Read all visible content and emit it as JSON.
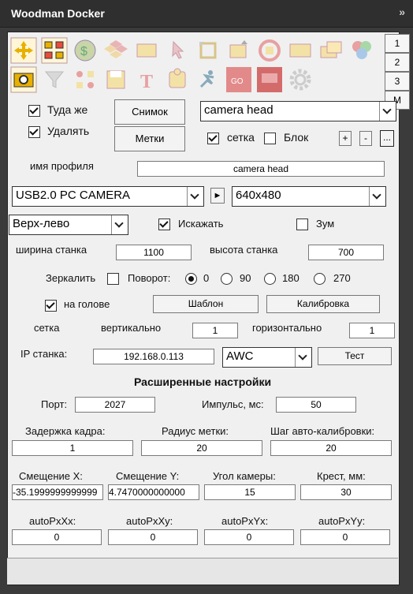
{
  "window": {
    "title": "Woodman Docker",
    "expand_icon": "double-chevron-right"
  },
  "tabs": [
    "1",
    "2",
    "3",
    "M"
  ],
  "toolbar_icons": [
    "move-arrows-icon",
    "grid-squares-icon",
    "dollar-coin-icon",
    "tiles-icon",
    "rectangle-icon",
    "cursor-pointer-icon",
    "rotate-frame-icon",
    "resize-height-icon",
    "rotate-circle-icon",
    "rectangle-outline-icon",
    "layers-icon",
    "color-wheel-icon",
    "camera-icon",
    "funnel-icon",
    "tools-icon",
    "save-disk-icon",
    "text-t-icon",
    "puzzle-icon",
    "runner-icon",
    "grid-red-icon",
    "grid-red-2-icon",
    "gear-icon"
  ],
  "row1": {
    "tuda_zhe": "Туда же",
    "snapshot": "Снимок",
    "camera_select": "camera head"
  },
  "row2": {
    "delete": "Удалять",
    "marks": "Метки",
    "grid": "сетка",
    "block": "Блок",
    "plus": "+",
    "minus": "-",
    "more": "..."
  },
  "profile": {
    "label": "имя профиля",
    "value": "camera head"
  },
  "camera_device": {
    "value": "USB2.0 PC CAMERA",
    "play": "►",
    "resolution": "640x480"
  },
  "corner": {
    "value": "Верх-лево",
    "distort": "Искажать",
    "zoom": "Зум"
  },
  "machine": {
    "width_label": "ширина станка",
    "width_value": "1100",
    "height_label": "высота станка",
    "height_value": "700"
  },
  "mirror": {
    "label": "Зеркалить",
    "rotation_label": "Поворот:",
    "options": [
      "0",
      "90",
      "180",
      "270"
    ]
  },
  "head": {
    "on_head": "на голове",
    "template": "Шаблон",
    "calibration": "Калибровка"
  },
  "grid_row": {
    "label": "сетка",
    "vertical": "вертикально",
    "vertical_value": "1",
    "horizontal": "горизонтально",
    "horizontal_value": "1"
  },
  "ip": {
    "label": "IP станка:",
    "value": "192.168.0.113",
    "mode": "AWC",
    "test": "Тест"
  },
  "advanced": {
    "title": "Расширенные настройки"
  },
  "port": {
    "label": "Порт:",
    "value": "2027",
    "pulse_label": "Импульс, мс:",
    "pulse_value": "50"
  },
  "frame": {
    "delay_label": "Задержка кадра:",
    "delay_value": "1",
    "radius_label": "Радиус метки:",
    "radius_value": "20",
    "step_label": "Шаг авто-калибровки:",
    "step_value": "20"
  },
  "offsets": {
    "x_label": "Смещение X:",
    "x_value": "-35.1999999999999",
    "y_label": "Смещение Y:",
    "y_value": "4.7470000000000",
    "angle_label": "Угол камеры:",
    "angle_value": "15",
    "cross_label": "Крест, мм:",
    "cross_value": "30"
  },
  "autopx": {
    "xx_label": "autoPxXx:",
    "xx_value": "0",
    "xy_label": "autoPxXy:",
    "xy_value": "0",
    "yx_label": "autoPxYx:",
    "yx_value": "0",
    "yy_label": "autoPxYy:",
    "yy_value": "0"
  }
}
